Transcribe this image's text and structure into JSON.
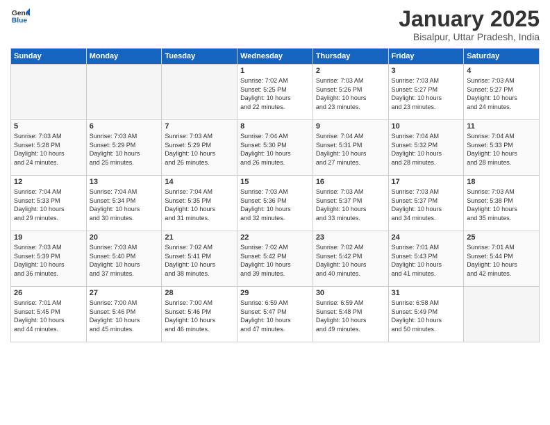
{
  "header": {
    "logo_general": "General",
    "logo_blue": "Blue",
    "title": "January 2025",
    "subtitle": "Bisalpur, Uttar Pradesh, India"
  },
  "days_of_week": [
    "Sunday",
    "Monday",
    "Tuesday",
    "Wednesday",
    "Thursday",
    "Friday",
    "Saturday"
  ],
  "weeks": [
    [
      {
        "day": "",
        "info": ""
      },
      {
        "day": "",
        "info": ""
      },
      {
        "day": "",
        "info": ""
      },
      {
        "day": "1",
        "info": "Sunrise: 7:02 AM\nSunset: 5:25 PM\nDaylight: 10 hours\nand 22 minutes."
      },
      {
        "day": "2",
        "info": "Sunrise: 7:03 AM\nSunset: 5:26 PM\nDaylight: 10 hours\nand 23 minutes."
      },
      {
        "day": "3",
        "info": "Sunrise: 7:03 AM\nSunset: 5:27 PM\nDaylight: 10 hours\nand 23 minutes."
      },
      {
        "day": "4",
        "info": "Sunrise: 7:03 AM\nSunset: 5:27 PM\nDaylight: 10 hours\nand 24 minutes."
      }
    ],
    [
      {
        "day": "5",
        "info": "Sunrise: 7:03 AM\nSunset: 5:28 PM\nDaylight: 10 hours\nand 24 minutes."
      },
      {
        "day": "6",
        "info": "Sunrise: 7:03 AM\nSunset: 5:29 PM\nDaylight: 10 hours\nand 25 minutes."
      },
      {
        "day": "7",
        "info": "Sunrise: 7:03 AM\nSunset: 5:29 PM\nDaylight: 10 hours\nand 26 minutes."
      },
      {
        "day": "8",
        "info": "Sunrise: 7:04 AM\nSunset: 5:30 PM\nDaylight: 10 hours\nand 26 minutes."
      },
      {
        "day": "9",
        "info": "Sunrise: 7:04 AM\nSunset: 5:31 PM\nDaylight: 10 hours\nand 27 minutes."
      },
      {
        "day": "10",
        "info": "Sunrise: 7:04 AM\nSunset: 5:32 PM\nDaylight: 10 hours\nand 28 minutes."
      },
      {
        "day": "11",
        "info": "Sunrise: 7:04 AM\nSunset: 5:33 PM\nDaylight: 10 hours\nand 28 minutes."
      }
    ],
    [
      {
        "day": "12",
        "info": "Sunrise: 7:04 AM\nSunset: 5:33 PM\nDaylight: 10 hours\nand 29 minutes."
      },
      {
        "day": "13",
        "info": "Sunrise: 7:04 AM\nSunset: 5:34 PM\nDaylight: 10 hours\nand 30 minutes."
      },
      {
        "day": "14",
        "info": "Sunrise: 7:04 AM\nSunset: 5:35 PM\nDaylight: 10 hours\nand 31 minutes."
      },
      {
        "day": "15",
        "info": "Sunrise: 7:03 AM\nSunset: 5:36 PM\nDaylight: 10 hours\nand 32 minutes."
      },
      {
        "day": "16",
        "info": "Sunrise: 7:03 AM\nSunset: 5:37 PM\nDaylight: 10 hours\nand 33 minutes."
      },
      {
        "day": "17",
        "info": "Sunrise: 7:03 AM\nSunset: 5:37 PM\nDaylight: 10 hours\nand 34 minutes."
      },
      {
        "day": "18",
        "info": "Sunrise: 7:03 AM\nSunset: 5:38 PM\nDaylight: 10 hours\nand 35 minutes."
      }
    ],
    [
      {
        "day": "19",
        "info": "Sunrise: 7:03 AM\nSunset: 5:39 PM\nDaylight: 10 hours\nand 36 minutes."
      },
      {
        "day": "20",
        "info": "Sunrise: 7:03 AM\nSunset: 5:40 PM\nDaylight: 10 hours\nand 37 minutes."
      },
      {
        "day": "21",
        "info": "Sunrise: 7:02 AM\nSunset: 5:41 PM\nDaylight: 10 hours\nand 38 minutes."
      },
      {
        "day": "22",
        "info": "Sunrise: 7:02 AM\nSunset: 5:42 PM\nDaylight: 10 hours\nand 39 minutes."
      },
      {
        "day": "23",
        "info": "Sunrise: 7:02 AM\nSunset: 5:42 PM\nDaylight: 10 hours\nand 40 minutes."
      },
      {
        "day": "24",
        "info": "Sunrise: 7:01 AM\nSunset: 5:43 PM\nDaylight: 10 hours\nand 41 minutes."
      },
      {
        "day": "25",
        "info": "Sunrise: 7:01 AM\nSunset: 5:44 PM\nDaylight: 10 hours\nand 42 minutes."
      }
    ],
    [
      {
        "day": "26",
        "info": "Sunrise: 7:01 AM\nSunset: 5:45 PM\nDaylight: 10 hours\nand 44 minutes."
      },
      {
        "day": "27",
        "info": "Sunrise: 7:00 AM\nSunset: 5:46 PM\nDaylight: 10 hours\nand 45 minutes."
      },
      {
        "day": "28",
        "info": "Sunrise: 7:00 AM\nSunset: 5:46 PM\nDaylight: 10 hours\nand 46 minutes."
      },
      {
        "day": "29",
        "info": "Sunrise: 6:59 AM\nSunset: 5:47 PM\nDaylight: 10 hours\nand 47 minutes."
      },
      {
        "day": "30",
        "info": "Sunrise: 6:59 AM\nSunset: 5:48 PM\nDaylight: 10 hours\nand 49 minutes."
      },
      {
        "day": "31",
        "info": "Sunrise: 6:58 AM\nSunset: 5:49 PM\nDaylight: 10 hours\nand 50 minutes."
      },
      {
        "day": "",
        "info": ""
      }
    ]
  ]
}
